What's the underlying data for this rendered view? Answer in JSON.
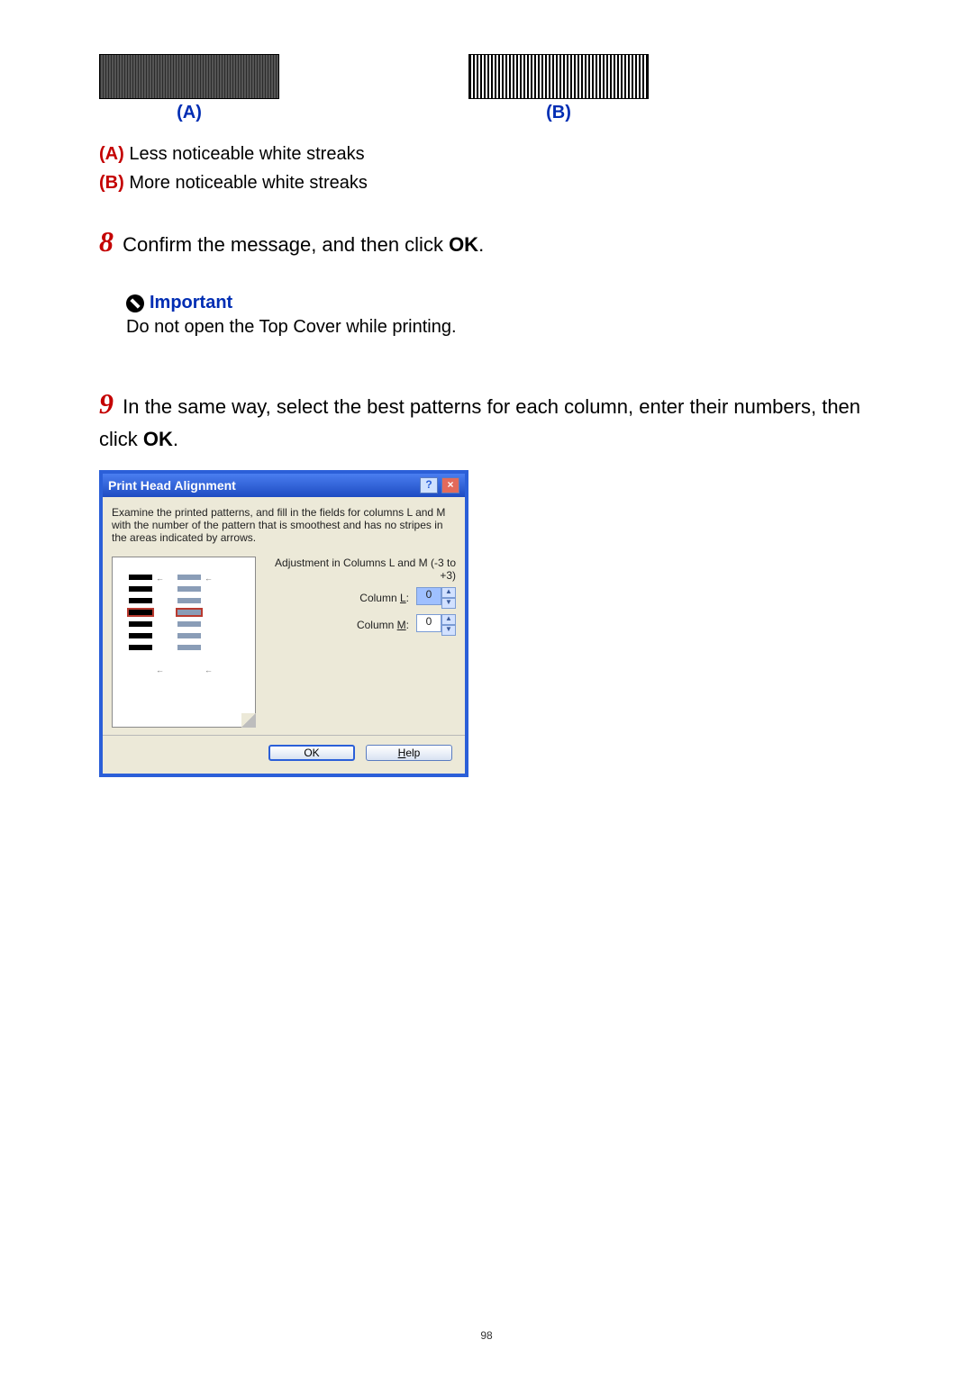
{
  "patterns": {
    "a_label": "(A)",
    "b_label": "(B)"
  },
  "legend": {
    "a_key": "(A)",
    "a_text": " Less noticeable white streaks",
    "b_key": "(B)",
    "b_text": " More noticeable white streaks"
  },
  "step8": {
    "num": "8",
    "text_before_bold": " Confirm the message, and then click ",
    "bold": "OK",
    "text_after_bold": "."
  },
  "important": {
    "heading": "Important",
    "body": "Do not open the Top Cover while printing."
  },
  "step9": {
    "num": "9",
    "text_before_bold": " In the same way, select the best patterns for each column, enter their numbers, then click ",
    "bold": "OK",
    "text_after_bold": "."
  },
  "dialog": {
    "title": "Print Head Alignment",
    "instruction": "Examine the printed patterns, and fill in the fields for columns L and M with the number of the pattern that is smoothest and has no stripes in the areas indicated by arrows.",
    "adjustment_range": "Adjustment in Columns L and M (-3 to +3)",
    "column_l_label_pre": "Column ",
    "column_l_key": "L",
    "column_l_label_post": ":",
    "column_l_value": "0",
    "column_m_label_pre": "Column ",
    "column_m_key": "M",
    "column_m_label_post": ":",
    "column_m_value": "0",
    "ok_label": "OK",
    "help_key": "H",
    "help_rest": "elp"
  },
  "page_number": "98"
}
